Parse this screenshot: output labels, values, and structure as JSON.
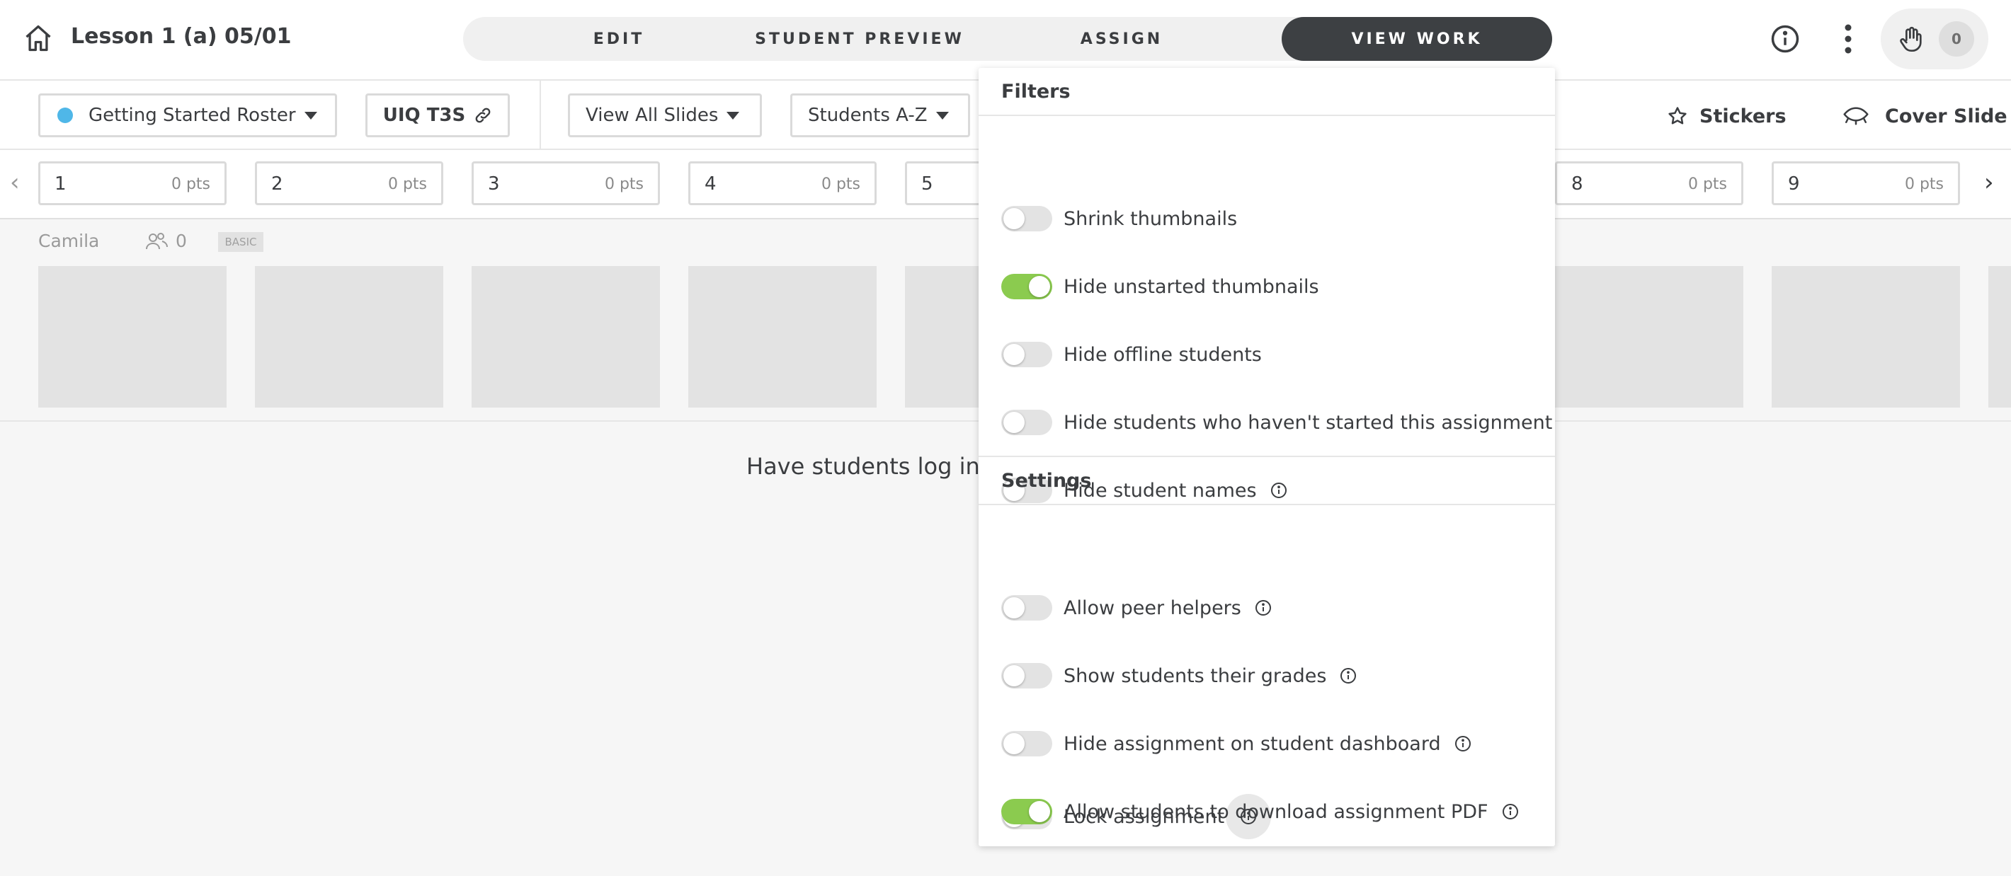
{
  "header": {
    "title": "Lesson 1 (a) 05/01",
    "tabs": [
      {
        "label": "EDIT",
        "active": false
      },
      {
        "label": "STUDENT PREVIEW",
        "active": false
      },
      {
        "label": "ASSIGN",
        "active": false
      },
      {
        "label": "VIEW WORK",
        "active": true
      }
    ],
    "hand_count": "0",
    "icons": [
      "home-icon",
      "info-icon",
      "more-vertical-icon",
      "raised-hand-icon"
    ]
  },
  "toolbar": {
    "roster_label": "Getting Started Roster",
    "roster_color": "#4fb7e8",
    "code_label": "UIQ T3S",
    "slides_filter": "View All Slides",
    "sort_label": "Students A-Z",
    "stickers_label": "Stickers",
    "cover_slide_label": "Cover Slide"
  },
  "slides": [
    {
      "num": "1",
      "pts": "0 pts"
    },
    {
      "num": "2",
      "pts": "0 pts"
    },
    {
      "num": "3",
      "pts": "0 pts"
    },
    {
      "num": "4",
      "pts": "0 pts"
    },
    {
      "num": "5",
      "pts": ""
    },
    {
      "num": "8",
      "pts": "0 pts"
    },
    {
      "num": "9",
      "pts": "0 pts"
    }
  ],
  "student": {
    "name": "Camila",
    "helper_count": "0",
    "badge": "BASIC"
  },
  "empty_message": "Have students log in",
  "panel": {
    "filters_title": "Filters",
    "filters": [
      {
        "label": "Shrink thumbnails",
        "on": false,
        "info": false
      },
      {
        "label": "Hide unstarted thumbnails",
        "on": true,
        "info": false
      },
      {
        "label": "Hide offline students",
        "on": false,
        "info": false
      },
      {
        "label": "Hide students who haven't started this assignment",
        "on": false,
        "info": false
      },
      {
        "label": "Hide student names",
        "on": false,
        "info": true
      }
    ],
    "settings_title": "Settings",
    "settings": [
      {
        "label": "Allow peer helpers",
        "on": false,
        "info": true
      },
      {
        "label": "Show students their grades",
        "on": false,
        "info": true
      },
      {
        "label": "Hide assignment on student dashboard",
        "on": false,
        "info": true
      },
      {
        "label": "Lock assignment",
        "on": false,
        "info": true
      },
      {
        "label": "Allow students to download assignment PDF",
        "on": true,
        "info": true
      }
    ],
    "toggle_on_color": "#8bcb4f"
  }
}
